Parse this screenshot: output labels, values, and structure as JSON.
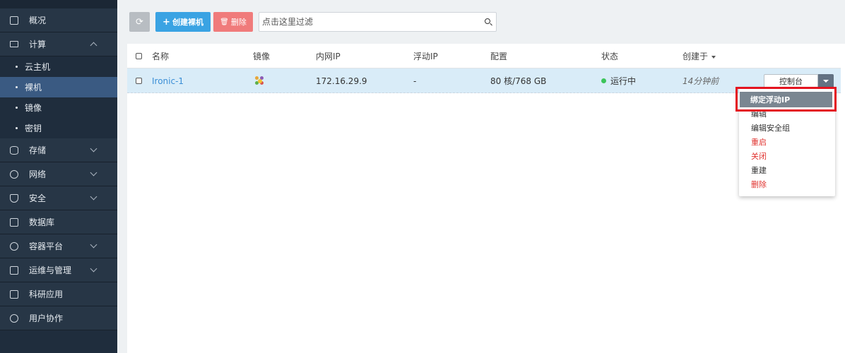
{
  "sidebar": {
    "items": [
      {
        "label": "概况",
        "icon": "copy-icon",
        "expandable": false
      },
      {
        "label": "计算",
        "icon": "monitor-icon",
        "expandable": true,
        "expanded": true
      },
      {
        "label": "存储",
        "icon": "database-icon",
        "expandable": true
      },
      {
        "label": "网络",
        "icon": "network-icon",
        "expandable": true
      },
      {
        "label": "安全",
        "icon": "shield-icon",
        "expandable": true
      },
      {
        "label": "数据库",
        "icon": "server-icon",
        "expandable": false
      },
      {
        "label": "容器平台",
        "icon": "container-icon",
        "expandable": true
      },
      {
        "label": "运维与管理",
        "icon": "calendar-icon",
        "expandable": true
      },
      {
        "label": "科研应用",
        "icon": "save-icon",
        "expandable": false
      },
      {
        "label": "用户协作",
        "icon": "users-icon",
        "expandable": false
      }
    ],
    "compute_sub": [
      {
        "label": "云主机",
        "active": false
      },
      {
        "label": "裸机",
        "active": true
      },
      {
        "label": "镜像",
        "active": false
      },
      {
        "label": "密钥",
        "active": false
      }
    ]
  },
  "toolbar": {
    "refresh_icon": "refresh-icon",
    "create_label": "创建裸机",
    "delete_label": "删除",
    "search_placeholder": "点击这里过滤"
  },
  "table": {
    "headers": {
      "name": "名称",
      "image": "镜像",
      "ip": "内网IP",
      "floating_ip": "浮动IP",
      "config": "配置",
      "status": "状态",
      "created": "创建于"
    },
    "rows": [
      {
        "name": "Ironic-1",
        "ip": "172.16.29.9",
        "floating_ip": "-",
        "config": "80 核/768 GB",
        "status": "运行中",
        "status_color": "#3cc45a",
        "created": "14分钟前"
      }
    ]
  },
  "actions": {
    "console_label": "控制台",
    "menu": [
      {
        "label": "绑定浮动IP",
        "danger": false,
        "highlighted": true
      },
      {
        "label": "编辑",
        "danger": false
      },
      {
        "label": "编辑安全组",
        "danger": false
      },
      {
        "label": "重启",
        "danger": true
      },
      {
        "label": "关闭",
        "danger": true
      },
      {
        "label": "重建",
        "danger": false
      },
      {
        "label": "删除",
        "danger": true
      }
    ]
  },
  "colors": {
    "primary": "#3aa3e3",
    "danger": "#f07b7b",
    "highlight_border": "#e4131f"
  }
}
